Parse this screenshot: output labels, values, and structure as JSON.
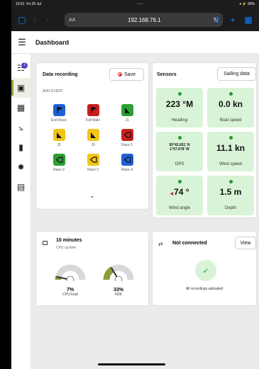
{
  "status_bar": {
    "time": "13:01",
    "date": "Fri 29 Jul",
    "battery": "90%"
  },
  "browser": {
    "aa_label": "AA",
    "url": "192.168.76.1"
  },
  "header": {
    "title": "Dashboard"
  },
  "sidebar": {
    "badge_count": "7"
  },
  "recording": {
    "title": "Data recording",
    "save_label": "Save",
    "add_event_label": "ADD EVENT",
    "events": [
      {
        "label": "End Race",
        "color": "#1f5fd6",
        "icon": "flag-icon"
      },
      {
        "label": "Full Main",
        "color": "#c81f1f",
        "icon": "flag-icon"
      },
      {
        "label": "J1",
        "color": "#2e9e36",
        "icon": "sail-icon"
      },
      {
        "label": "J2",
        "color": "#f2c417",
        "icon": "sail-icon"
      },
      {
        "label": "J3",
        "color": "#f2c417",
        "icon": "sail-icon"
      },
      {
        "label": "Race 1",
        "color": "#c81f1f",
        "icon": "arrow-left-icon"
      },
      {
        "label": "Race 2",
        "color": "#2e9e36",
        "icon": "arrow-left-icon"
      },
      {
        "label": "Race 3",
        "color": "#f2c417",
        "icon": "arrow-left-icon"
      },
      {
        "label": "Race 4",
        "color": "#1f5fd6",
        "icon": "arrow-left-icon"
      }
    ]
  },
  "sensors": {
    "title": "Sensors",
    "sailing_button": "Sailing data",
    "tiles": [
      {
        "value": "223 °M",
        "label": "Heading"
      },
      {
        "value": "0.0 kn",
        "label": "Boat speed"
      },
      {
        "value_line1": "50°42.651' N",
        "value_line2": "1°57.678' W",
        "label": "GPS"
      },
      {
        "value": "11.1 kn",
        "label": "Wind speed"
      },
      {
        "value": "74 °",
        "label": "Wind angle"
      },
      {
        "value": "1.5 m",
        "label": "Depth"
      }
    ]
  },
  "cpu": {
    "uptime": "10 minutes",
    "uptime_label": "CPU up time",
    "gauges": [
      {
        "value": "7%",
        "label": "CPU load",
        "fraction": 0.07
      },
      {
        "value": "33%",
        "label": "N2K",
        "fraction": 0.33
      }
    ]
  },
  "connection": {
    "title": "Not connected",
    "view_label": "View",
    "message": "All recordings uploaded"
  }
}
